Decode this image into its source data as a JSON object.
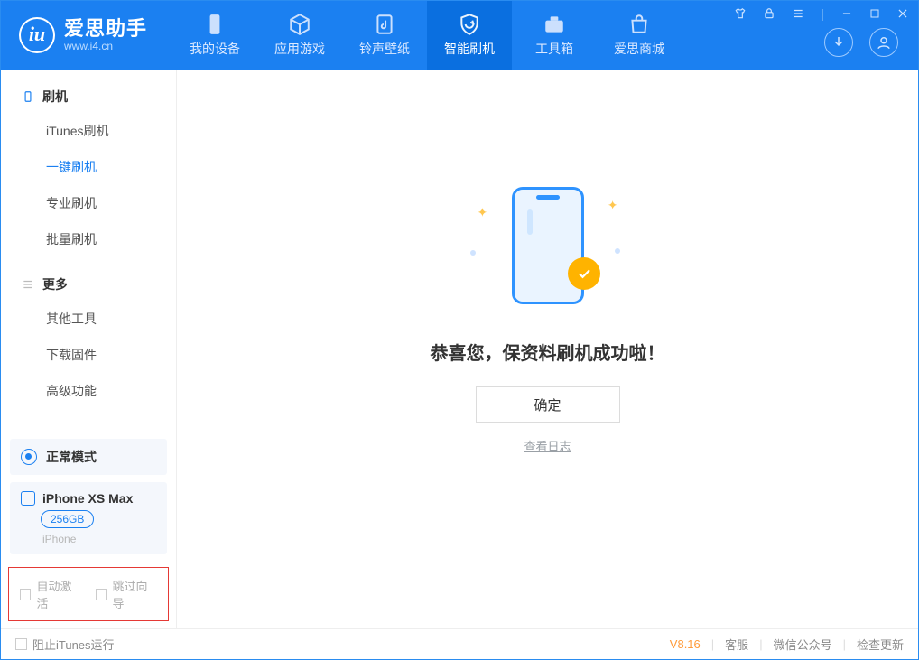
{
  "app": {
    "name": "爱思助手",
    "url": "www.i4.cn"
  },
  "nav": {
    "items": [
      {
        "label": "我的设备"
      },
      {
        "label": "应用游戏"
      },
      {
        "label": "铃声壁纸"
      },
      {
        "label": "智能刷机"
      },
      {
        "label": "工具箱"
      },
      {
        "label": "爱思商城"
      }
    ],
    "active_index": 3
  },
  "sidebar": {
    "section1": {
      "title": "刷机",
      "items": [
        "iTunes刷机",
        "一键刷机",
        "专业刷机",
        "批量刷机"
      ],
      "active_index": 1
    },
    "section2": {
      "title": "更多",
      "items": [
        "其他工具",
        "下载固件",
        "高级功能"
      ]
    },
    "mode": {
      "label": "正常模式"
    },
    "device": {
      "name": "iPhone XS Max",
      "storage": "256GB",
      "type": "iPhone"
    },
    "checkboxes": {
      "auto_activate": "自动激活",
      "skip_guide": "跳过向导"
    }
  },
  "main": {
    "success_text": "恭喜您，保资料刷机成功啦！",
    "confirm": "确定",
    "view_log": "查看日志"
  },
  "footer": {
    "block_itunes": "阻止iTunes运行",
    "version": "V8.16",
    "links": [
      "客服",
      "微信公众号",
      "检查更新"
    ]
  }
}
